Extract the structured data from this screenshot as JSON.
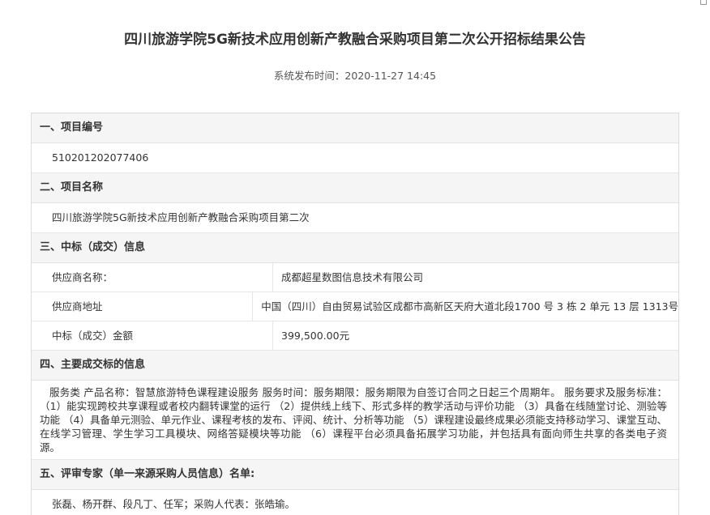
{
  "title": "四川旅游学院5G新技术应用创新产教融合采购项目第二次公开招标结果公告",
  "meta": "系统发布时间：2020-11-27 14:45",
  "sections": {
    "s1": {
      "heading": "一、项目编号",
      "value": "510201202077406"
    },
    "s2": {
      "heading": "二、项目名称",
      "value": "四川旅游学院5G新技术应用创新产教融合采购项目第二次"
    },
    "s3": {
      "heading": "三、中标（成交）信息",
      "rows": [
        {
          "label": "供应商名称：",
          "value": "成都超星数图信息技术有限公司"
        },
        {
          "label": "供应商地址",
          "value": "中国（四川）自由贸易试验区成都市高新区天府大道北段1700 号 3 栋 2 单元 13 层 1313号"
        },
        {
          "label": "中标（成交）金额",
          "value": "399,500.00元"
        }
      ]
    },
    "s4": {
      "heading": "四、主要成交标的信息",
      "text": "服务类 产品名称：智慧旅游特色课程建设服务 服务时间：服务期限：服务期限为自签订合同之日起三个周期年。 服务要求及服务标准： （1）能实现跨校共享课程或者校内翻转课堂的运行 （2）提供线上线下、形式多样的教学活动与评价功能 （3）具备在线随堂讨论、测验等功能 （4）具备单元测验、单元作业、课程考核的发布、评阅、统计、分析等功能 （5）课程建设最终成果必须能支持移动学习、课堂互动、在线学习管理、学生学习工具模块、网络答疑模块等功能 （6）课程平台必须具备拓展学习功能，并包括具有面向师生共享的各类电子资源。"
    },
    "s5": {
      "heading": "五、评审专家（单一来源采购人员信息）名单:",
      "value": "张磊、杨开群、段凡丁、任军；采购人代表：张皓瑜。"
    }
  }
}
